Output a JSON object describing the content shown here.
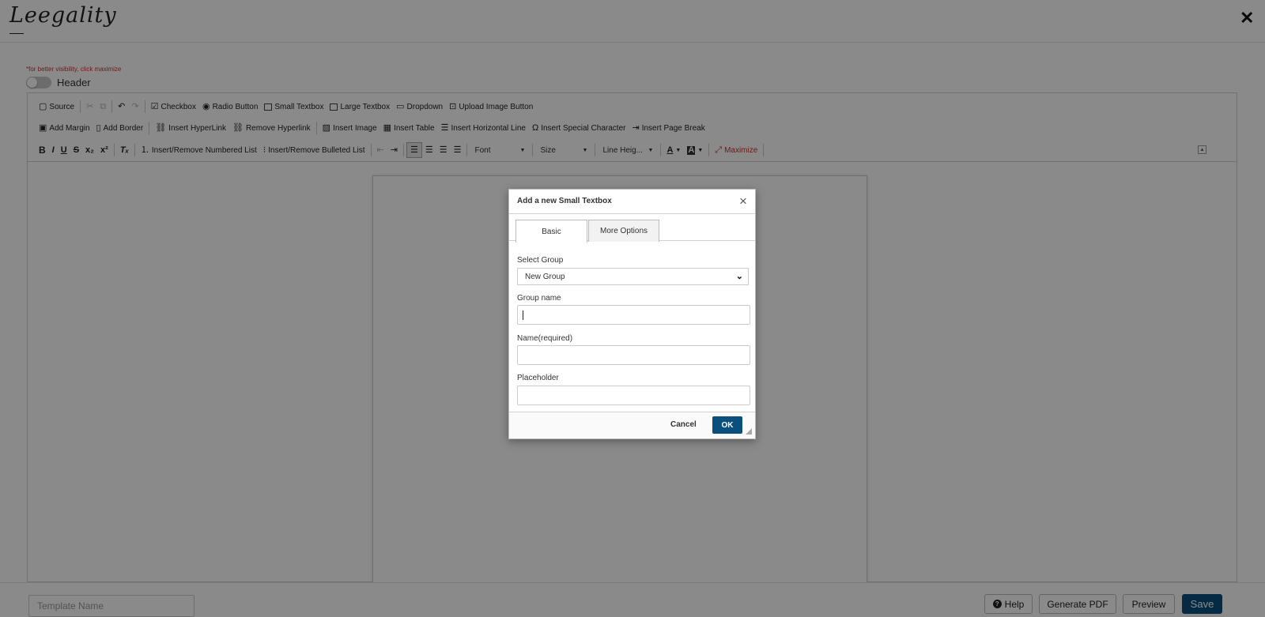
{
  "header": {
    "logo_text": "Leegality",
    "close_icon": "close-icon"
  },
  "hint": "*for better visibility, click maximize",
  "header_toggle": {
    "label": "Header",
    "on": false
  },
  "toolbar": {
    "row1": [
      {
        "label": "Source",
        "icon": "source-icon"
      },
      {
        "label": "Checkbox",
        "icon": "checkbox-icon"
      },
      {
        "label": "Radio Button",
        "icon": "radio-icon"
      },
      {
        "label": "Small Textbox",
        "icon": "small-textbox-icon"
      },
      {
        "label": "Large Textbox",
        "icon": "large-textbox-icon"
      },
      {
        "label": "Dropdown",
        "icon": "dropdown-icon"
      },
      {
        "label": "Upload Image Button",
        "icon": "upload-image-icon"
      }
    ],
    "row2": [
      {
        "label": "Add Margin",
        "icon": "margin-icon"
      },
      {
        "label": "Add Border",
        "icon": "border-icon"
      },
      {
        "label": "Insert HyperLink",
        "icon": "link-icon"
      },
      {
        "label": "Remove Hyperlink",
        "icon": "unlink-icon"
      },
      {
        "label": "Insert Image",
        "icon": "image-icon"
      },
      {
        "label": "Insert Table",
        "icon": "table-icon"
      },
      {
        "label": "Insert Horizontal Line",
        "icon": "horizontal-line-icon"
      },
      {
        "label": "Insert Special Character",
        "icon": "omega-icon"
      },
      {
        "label": "Insert Page Break",
        "icon": "page-break-icon"
      }
    ],
    "row3": {
      "numbered_list": "Insert/Remove Numbered List",
      "bulleted_list": "Insert/Remove Bulleted List",
      "font": "Font",
      "size": "Size",
      "line_height": "Line Heig...",
      "maximize": "Maximize"
    }
  },
  "dialog": {
    "title": "Add a new Small Textbox",
    "tabs": [
      {
        "label": "Basic",
        "active": true
      },
      {
        "label": "More Options",
        "active": false
      }
    ],
    "select_group": {
      "label": "Select Group",
      "value": "New Group"
    },
    "group_name": {
      "label": "Group name",
      "value": ""
    },
    "name": {
      "label": "Name(required)",
      "value": ""
    },
    "placeholder": {
      "label": "Placeholder",
      "value": ""
    },
    "cancel": "Cancel",
    "ok": "OK"
  },
  "bottom": {
    "template_placeholder": "Template Name",
    "help": "Help",
    "generate_pdf": "Generate PDF",
    "preview": "Preview",
    "save": "Save"
  },
  "colors": {
    "accent": "#0b4f7f",
    "hint_red": "#d32f2f",
    "overlay": "rgba(0,0,0,0.46)"
  }
}
